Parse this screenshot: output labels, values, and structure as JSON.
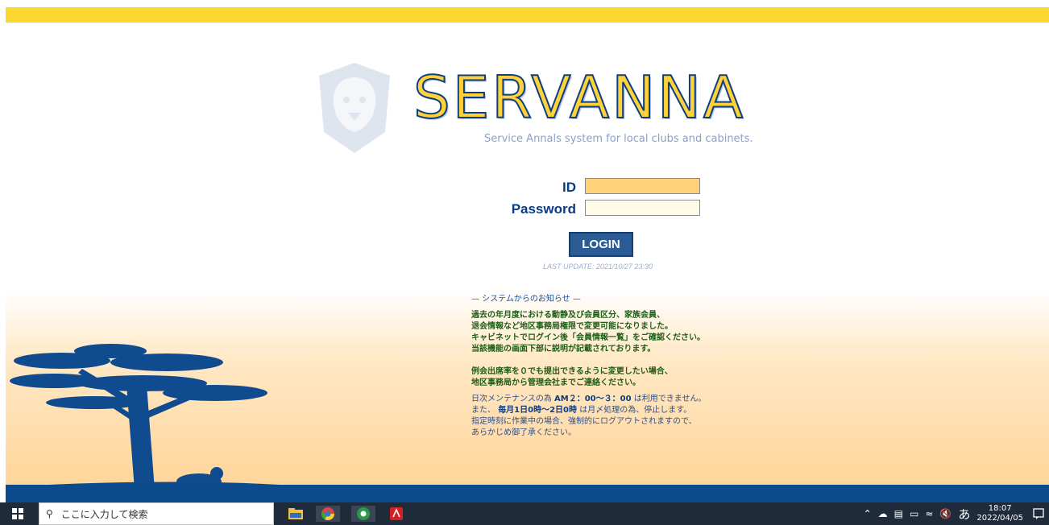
{
  "brand": {
    "logo_text": "SERVANNA",
    "tagline": "Service Annals system for local clubs and cabinets."
  },
  "login": {
    "id_label": "ID",
    "password_label": "Password",
    "id_value": "",
    "password_value": "",
    "button_label": "LOGIN",
    "last_update": "LAST UPDATE:    2021/10/27  23:30"
  },
  "notice": {
    "title": "— システムからのお知らせ —",
    "green1": "過去の年月度における動静及び会員区分、家族会員、",
    "green2": "退会情報など地区事務局権限で変更可能になりました。",
    "green3": "キャビネットでログイン後「会員情報一覧」をご確認ください。",
    "green4": "当該機能の画面下部に説明が記載されております。",
    "green5": "例会出席率を０でも提出できるように変更したい場合、",
    "green6": "地区事務局から管理会社までご連絡ください。",
    "maint1_a": "日次メンテナンスの為",
    "maint1_b": "AM２：00〜３：00",
    "maint1_c": "は利用できません。",
    "maint2_a": "また、",
    "maint2_b": "毎月1日0時〜2日0時",
    "maint2_c": "は月〆処理の為、停止します。",
    "maint3": "指定時刻に作業中の場合、強制的にログアウトされますので、",
    "maint4": "あらかじめ御了承ください。"
  },
  "taskbar": {
    "search_placeholder": "ここに入力して検索",
    "ime": "あ",
    "time": "18:07",
    "date": "2022/04/05"
  },
  "colors": {
    "topbar": "#fbd72f",
    "brand_blue": "#0a3c86",
    "login_button": "#2b5c96",
    "id_field_bg": "#ffd27a",
    "password_field_bg": "#fffbe6"
  }
}
